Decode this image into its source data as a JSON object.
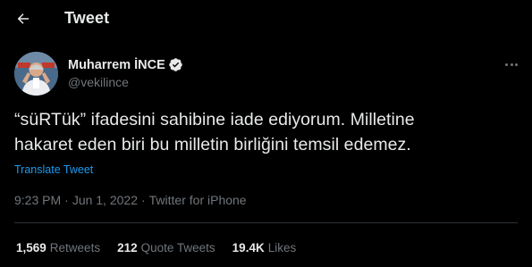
{
  "header": {
    "title": "Tweet",
    "back_icon": "arrow-left-icon"
  },
  "author": {
    "name": "Muharrem İNCE",
    "handle": "@vekilince",
    "verified": true,
    "verified_color": "#e7e9ea"
  },
  "tweet": {
    "text_line1": "“süRTük” ifadesini sahibine iade ediyorum. Milletine",
    "text_line2": "hakaret eden biri bu milletin birliğini temsil edemez.",
    "translate_label": "Translate Tweet"
  },
  "meta": {
    "time": "9:23 PM",
    "date": "Jun 1, 2022",
    "source": "Twitter for iPhone",
    "separator": "·"
  },
  "stats": {
    "retweets_count": "1,569",
    "retweets_label": "Retweets",
    "quotes_count": "212",
    "quotes_label": "Quote Tweets",
    "likes_count": "19.4K",
    "likes_label": "Likes"
  },
  "colors": {
    "background": "#000000",
    "text": "#e7e9ea",
    "secondary": "#71767b",
    "link": "#1d9bf0",
    "divider": "#2f3336"
  }
}
